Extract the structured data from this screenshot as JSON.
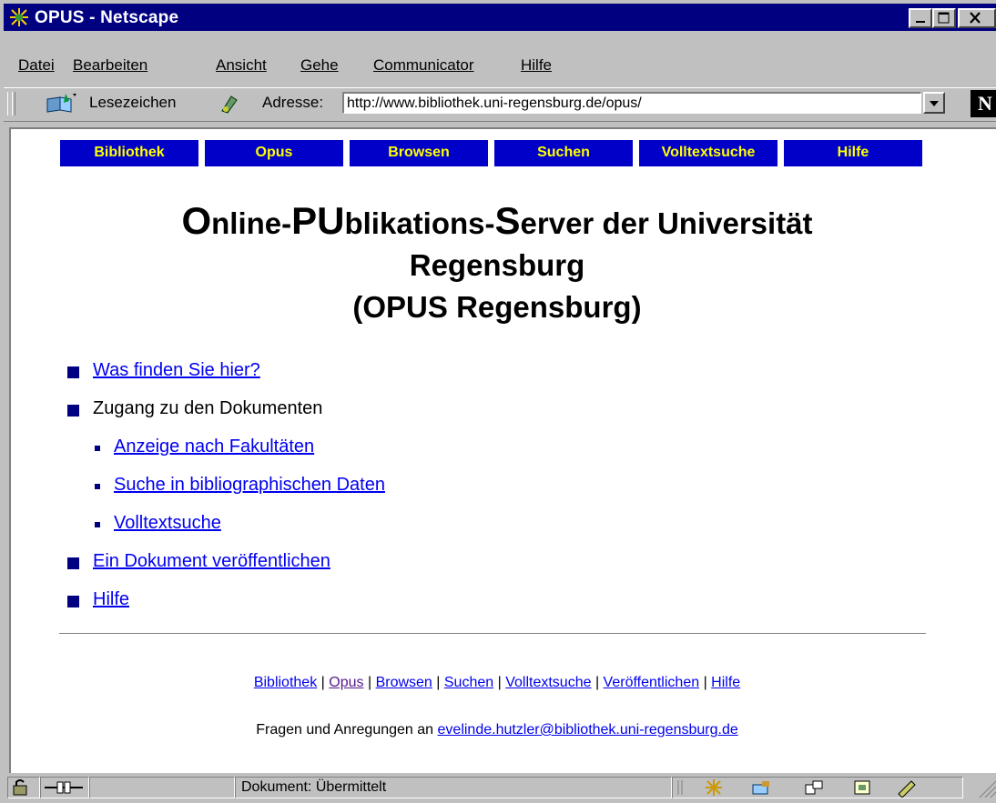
{
  "window": {
    "title": "OPUS - Netscape"
  },
  "menu": [
    "Datei",
    "Bearbeiten",
    "Ansicht",
    "Gehe",
    "Communicator",
    "Hilfe"
  ],
  "location": {
    "bookmarks_label": "Lesezeichen",
    "address_label": "Adresse:",
    "url": "http://www.bibliothek.uni-regensburg.de/opus/"
  },
  "nav_buttons": [
    "Bibliothek",
    "Opus",
    "Browsen",
    "Suchen",
    "Volltextsuche",
    "Hilfe"
  ],
  "heading": {
    "O": "O",
    "nline": "nline-",
    "PU": "PU",
    "blikations": "blikations-",
    "S": "S",
    "erver": "erver der Universität",
    "line2": "Regensburg",
    "line3": "(OPUS Regensburg)"
  },
  "list": {
    "item1": "Was finden Sie hier?",
    "item2": "Zugang zu den Dokumenten",
    "sub1": "Anzeige nach Fakultäten",
    "sub2": "Suche in bibliographischen Daten",
    "sub3": "Volltextsuche",
    "item3": "Ein Dokument veröffentlichen",
    "item4": "Hilfe"
  },
  "footer": {
    "links": [
      "Bibliothek",
      "Opus",
      "Browsen",
      "Suchen",
      "Volltextsuche",
      "Veröffentlichen",
      "Hilfe"
    ],
    "separator": "|",
    "contact_prefix": "Fragen und Anregungen an",
    "email": "evelinde.hutzler@bibliothek.uni-regensburg.de"
  },
  "status": {
    "text": "Dokument: Übermittelt"
  },
  "colors": {
    "titlebar": "#000080",
    "nav_bg": "#0000c8",
    "nav_text": "#ffff00",
    "link": "#0000ee",
    "visited": "#551a8b"
  }
}
